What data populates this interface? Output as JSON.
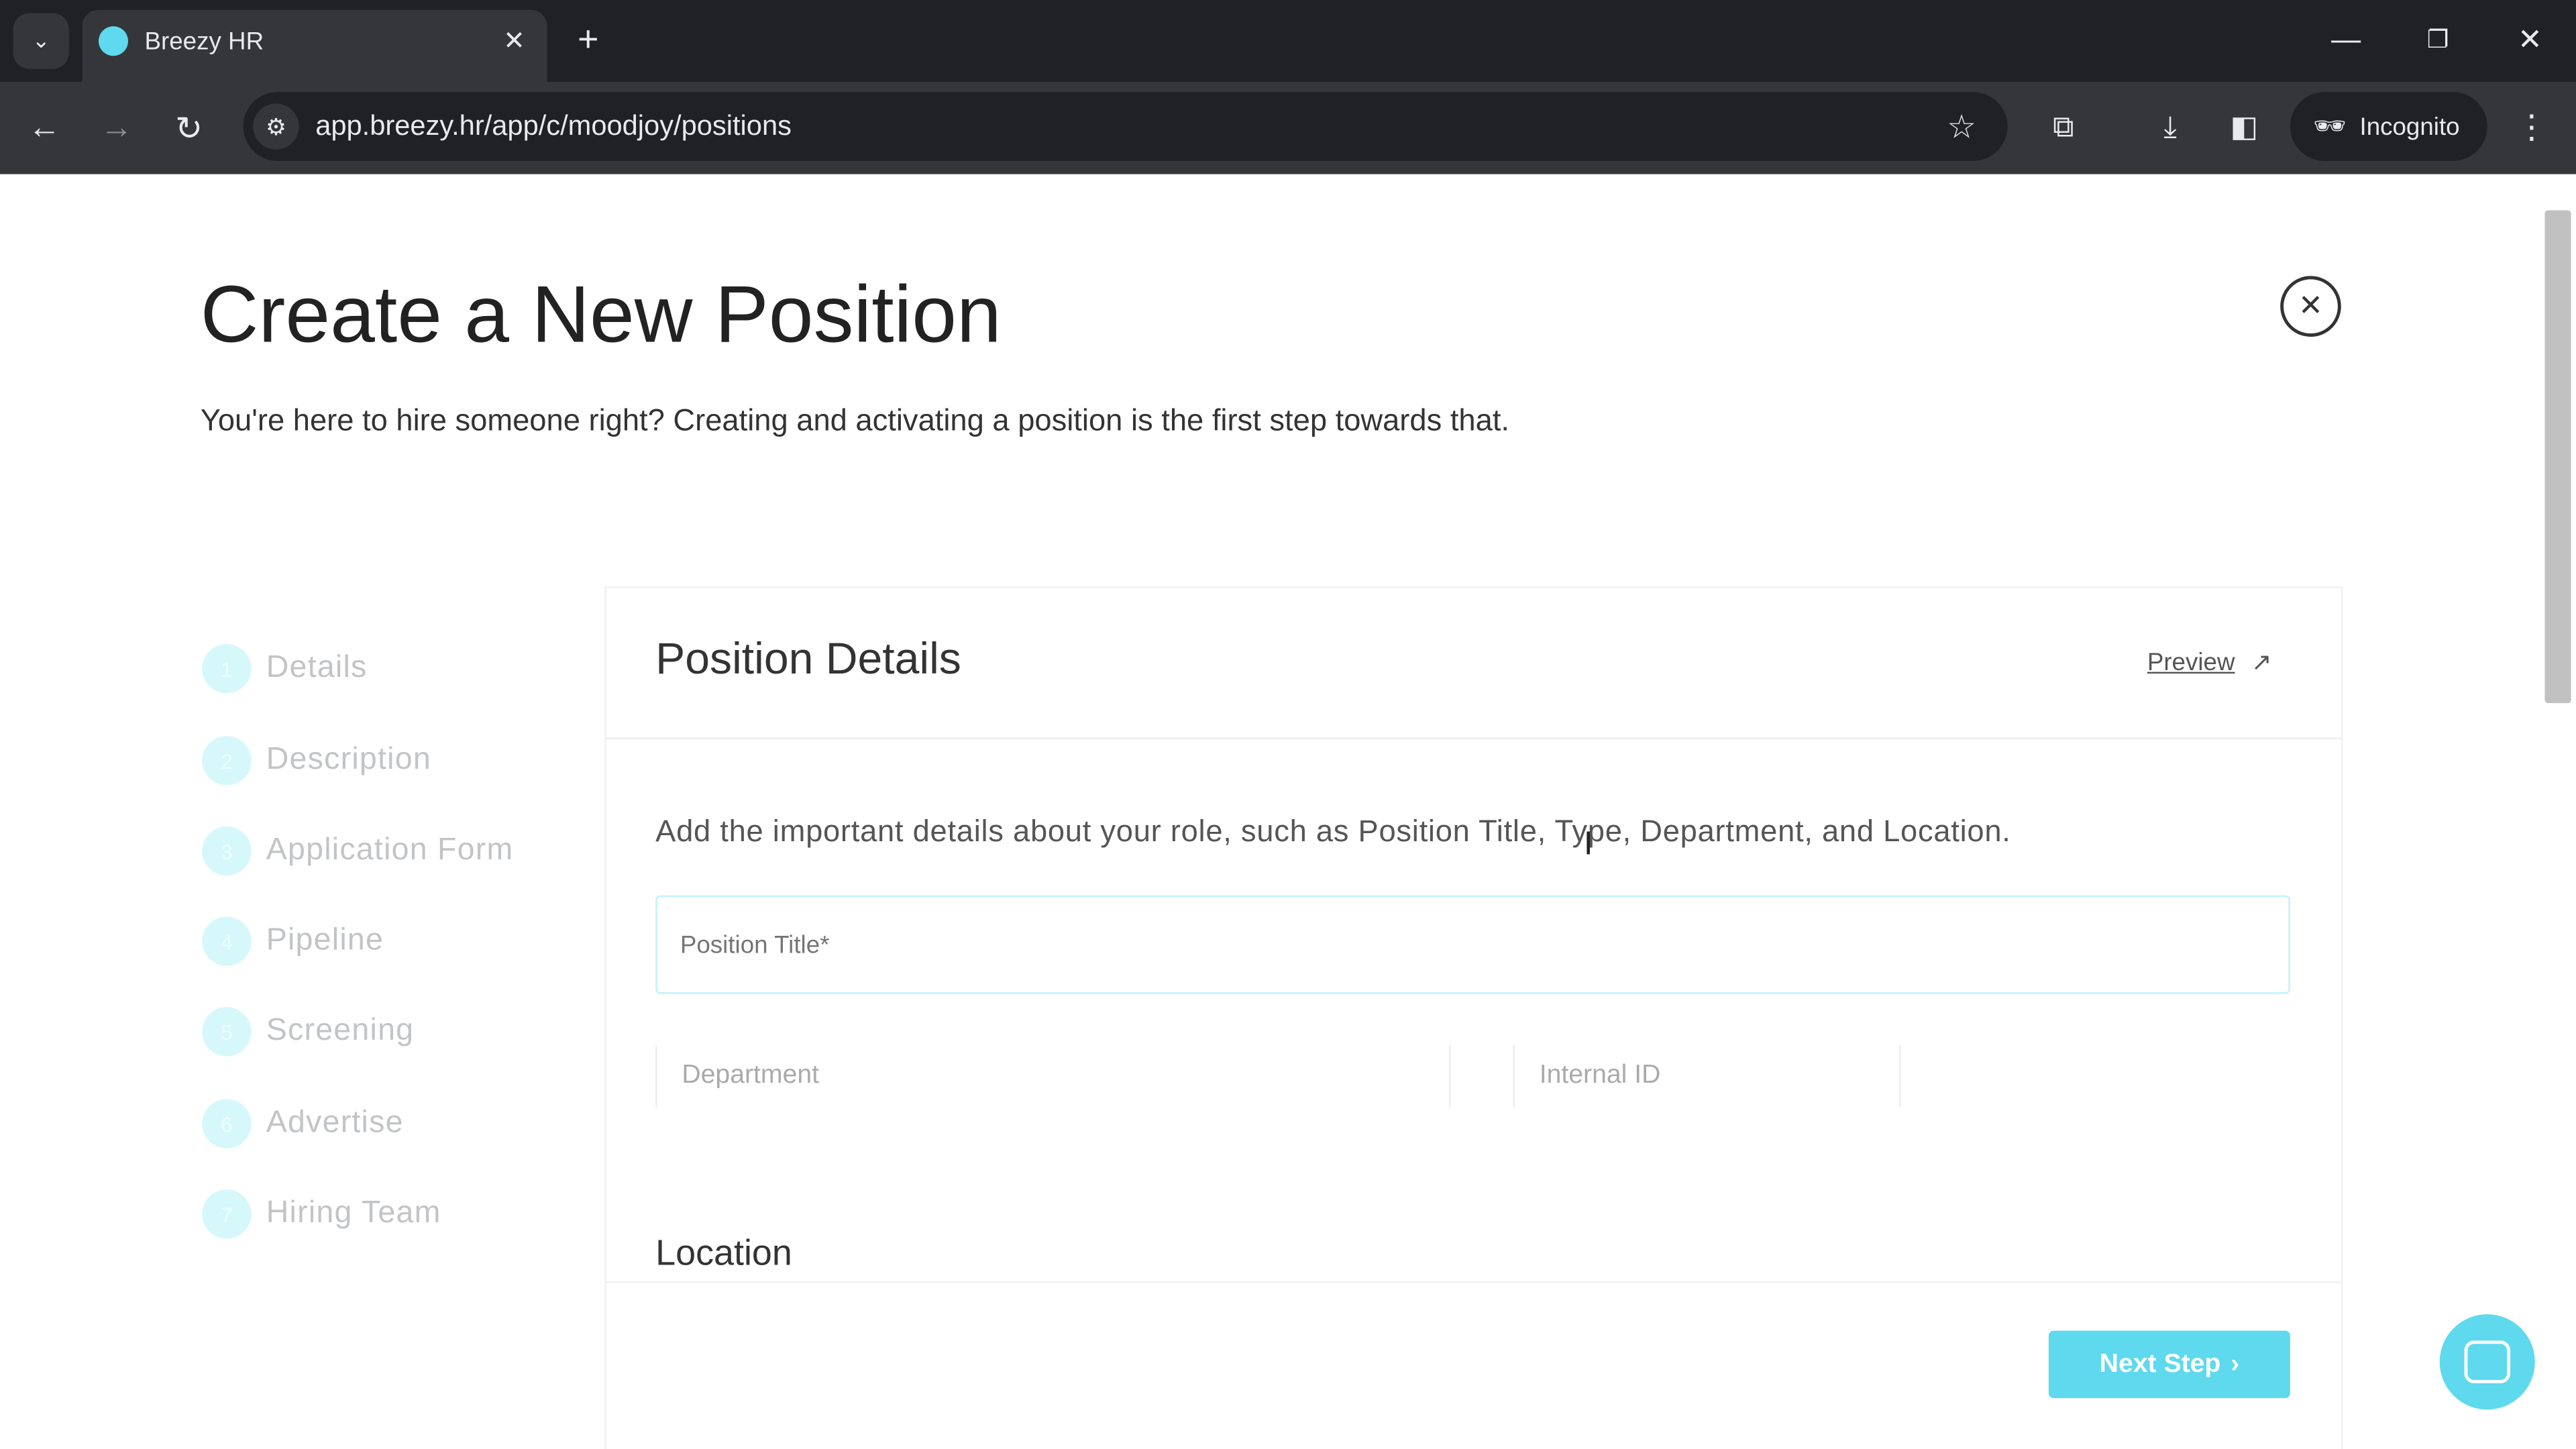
{
  "browser": {
    "tab_title": "Breezy HR",
    "url": "app.breezy.hr/app/c/moodjoy/positions",
    "profile_label": "Incognito"
  },
  "page": {
    "title": "Create a New Position",
    "subtitle": "You're here to hire someone right? Creating and activating a position is the first step towards that."
  },
  "steps": [
    {
      "num": "1",
      "label": "Details"
    },
    {
      "num": "2",
      "label": "Description"
    },
    {
      "num": "3",
      "label": "Application Form"
    },
    {
      "num": "4",
      "label": "Pipeline"
    },
    {
      "num": "5",
      "label": "Screening"
    },
    {
      "num": "6",
      "label": "Advertise"
    },
    {
      "num": "7",
      "label": "Hiring Team"
    }
  ],
  "card": {
    "title": "Position Details",
    "preview_label": "Preview",
    "intro": "Add the important details about your role, such as Position Title, Type, Department, and Location.",
    "position_title_placeholder": "Position Title*",
    "department_placeholder": "Department",
    "internal_id_placeholder": "Internal ID",
    "location_heading": "Location",
    "next_label": "Next Step"
  },
  "colors": {
    "accent": "#5ed9ee",
    "step_circle": "#d6f8fb"
  }
}
